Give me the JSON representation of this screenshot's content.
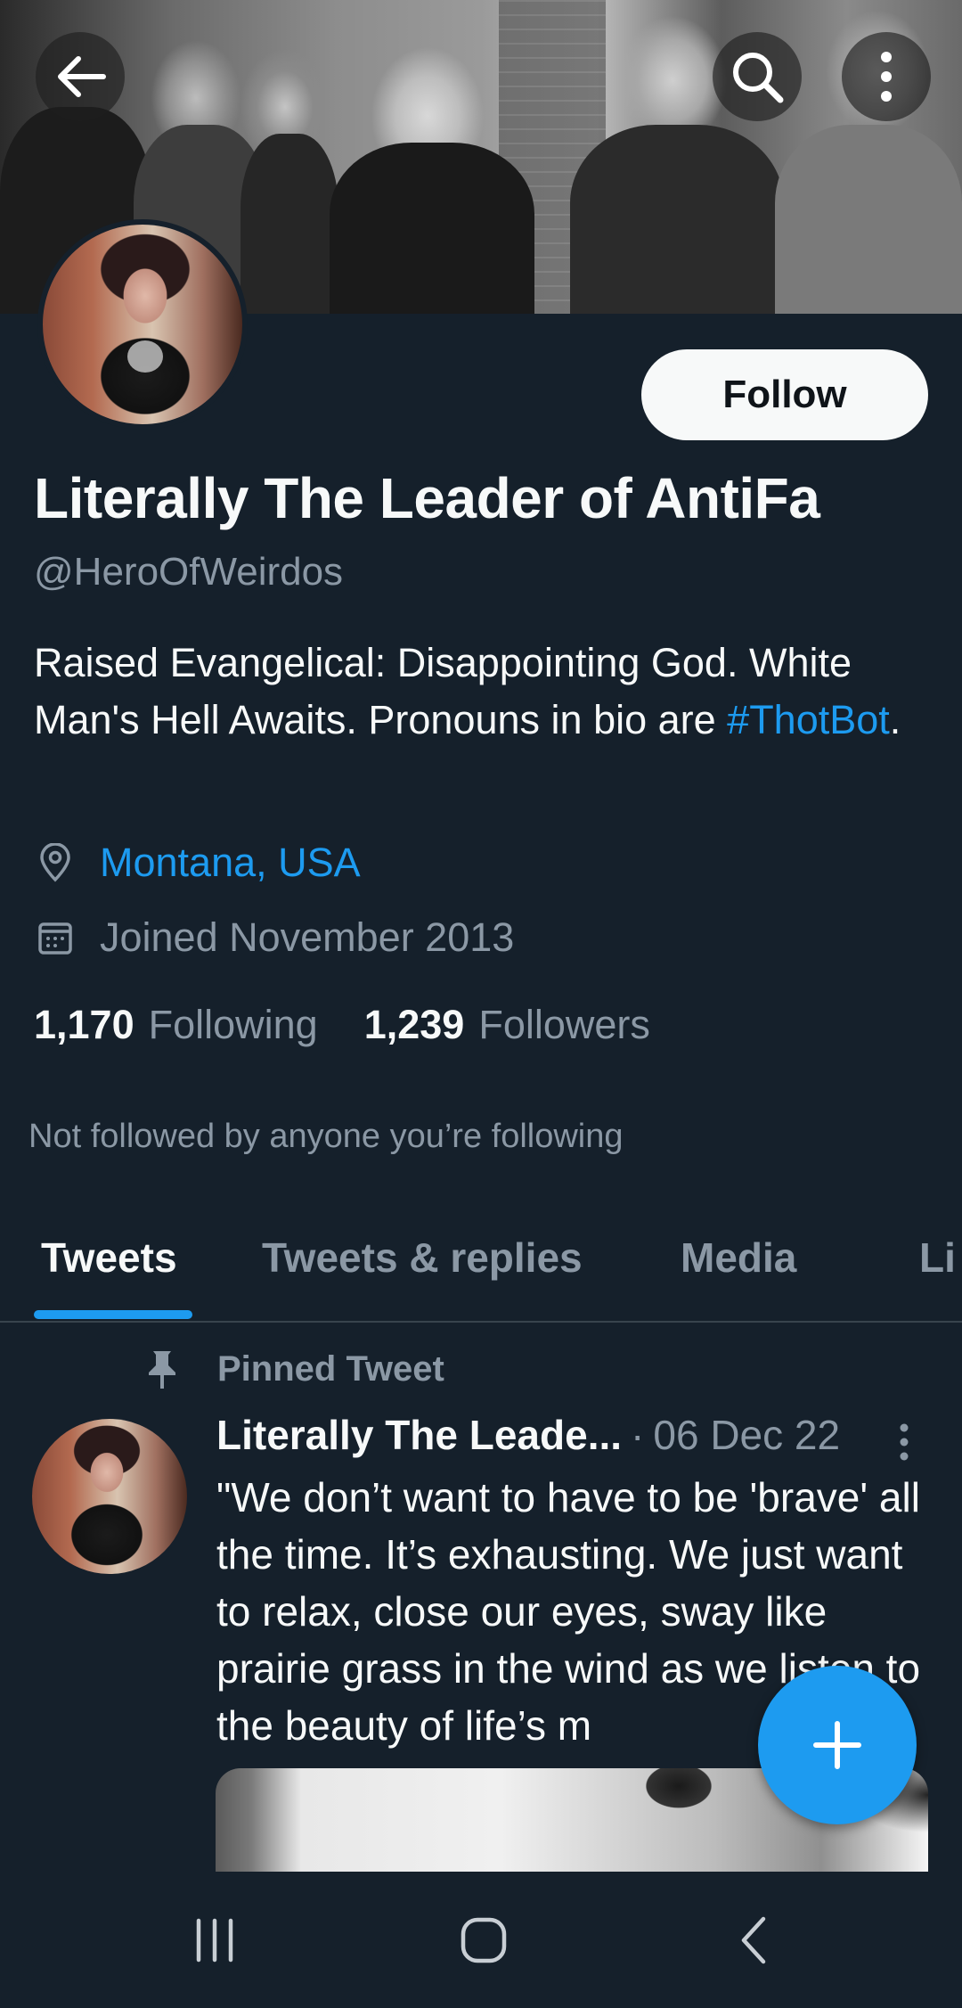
{
  "profile": {
    "display_name": "Literally The Leader of AntiFa",
    "handle": "@HeroOfWeirdos",
    "bio_text": "Raised Evangelical: Disappointing God. White Man's Hell Awaits. Pronouns in bio are ",
    "bio_hashtag": "#ThotBot",
    "bio_end": ".",
    "location": "Montana, USA",
    "joined": "Joined November 2013",
    "following_count": "1,170",
    "following_label": "Following",
    "followers_count": "1,239",
    "followers_label": "Followers",
    "not_followed_text": "Not followed by anyone you’re following",
    "follow_button": "Follow"
  },
  "header": {
    "back_icon": "arrow-left-icon",
    "search_icon": "search-icon",
    "more_icon": "more-vertical-icon"
  },
  "tabs": [
    {
      "label": "Tweets",
      "active": true
    },
    {
      "label": "Tweets & replies",
      "active": false
    },
    {
      "label": "Media",
      "active": false
    },
    {
      "label": "Li",
      "active": false
    }
  ],
  "pinned_tweet": {
    "pinned_label": "Pinned Tweet",
    "author": "Literally The Leade...",
    "separator": "·",
    "date": "06 Dec 22",
    "text": "\"We don’t want to have to be 'brave' all the time. It’s exhausting. We just want to relax, close our eyes, sway like prairie grass in the wind as we listen to the beauty of life’s m"
  },
  "fab": {
    "icon": "plus-icon"
  },
  "navbar": {
    "recents_icon": "recents-icon",
    "home_icon": "home-icon",
    "back_icon": "nav-back-icon"
  },
  "colors": {
    "background": "#15202b",
    "accent": "#1d9bf0",
    "secondary_text": "#8b98a5",
    "primary_text": "#f7f9f9"
  }
}
